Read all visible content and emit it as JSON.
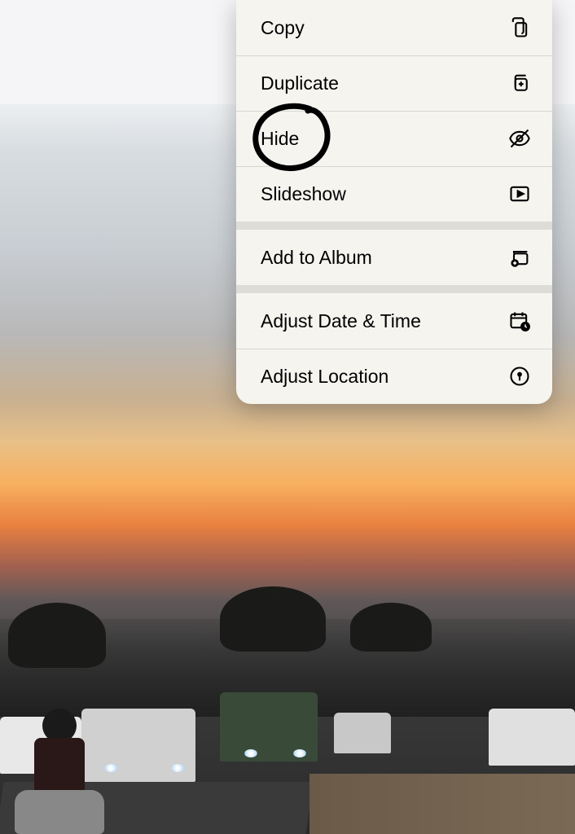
{
  "menu": {
    "items": [
      {
        "label": "Copy",
        "icon": "copy-icon"
      },
      {
        "label": "Duplicate",
        "icon": "duplicate-icon"
      },
      {
        "label": "Hide",
        "icon": "hide-icon"
      },
      {
        "label": "Slideshow",
        "icon": "slideshow-icon"
      },
      {
        "label": "Add to Album",
        "icon": "add-to-album-icon"
      },
      {
        "label": "Adjust Date & Time",
        "icon": "adjust-date-icon"
      },
      {
        "label": "Adjust Location",
        "icon": "adjust-location-icon"
      }
    ]
  },
  "annotation": {
    "circled_item": "Hide"
  }
}
